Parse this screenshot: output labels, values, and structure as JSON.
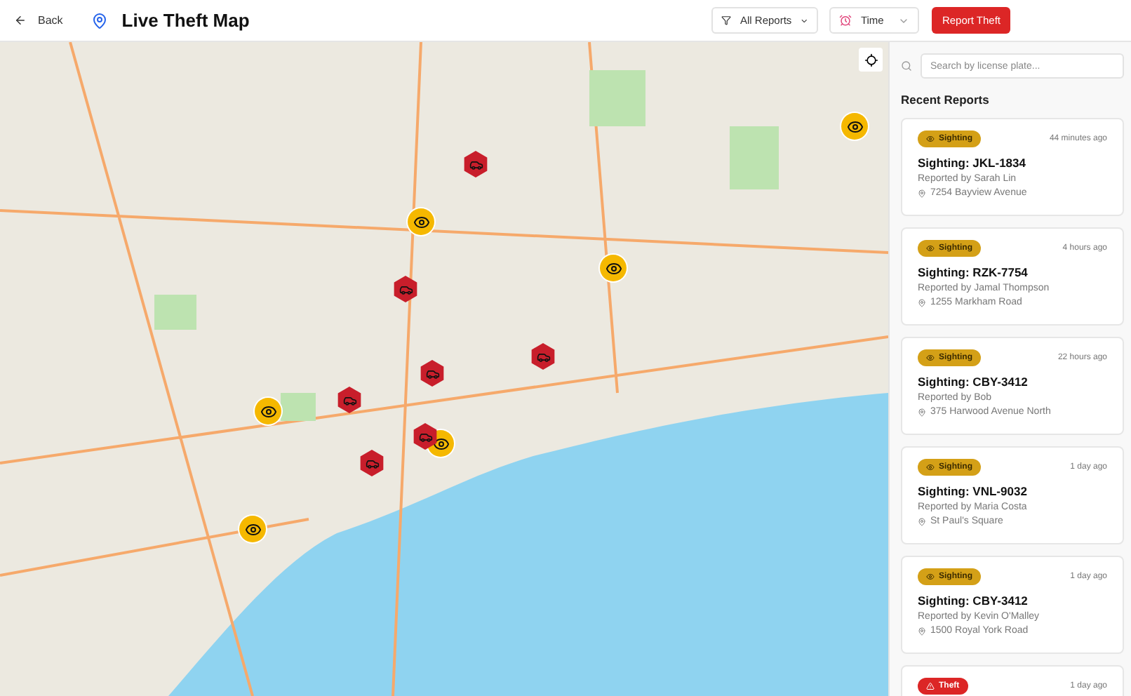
{
  "header": {
    "back": "Back",
    "title": "Live Theft Map",
    "filter": "All Reports",
    "time": "Time",
    "report_button": "Report Theft"
  },
  "map": {
    "markers": [
      {
        "kind": "sighting"
      },
      {
        "kind": "sighting"
      },
      {
        "kind": "sighting"
      },
      {
        "kind": "sighting"
      },
      {
        "kind": "sighting"
      },
      {
        "kind": "sighting"
      },
      {
        "kind": "theft"
      },
      {
        "kind": "theft"
      },
      {
        "kind": "theft"
      },
      {
        "kind": "theft"
      },
      {
        "kind": "theft"
      },
      {
        "kind": "theft"
      },
      {
        "kind": "theft"
      }
    ]
  },
  "sidebar": {
    "search": {
      "placeholder": "Search by license plate..."
    },
    "heading": "Recent Reports",
    "reports": [
      {
        "kind": "sighting",
        "badge": "Sighting",
        "time": "44 minutes ago",
        "title": "Sighting: JKL-1834",
        "reporter": "Reported by Sarah Lin",
        "address": "7254 Bayview Avenue"
      },
      {
        "kind": "sighting",
        "badge": "Sighting",
        "time": "4 hours ago",
        "title": "Sighting: RZK-7754",
        "reporter": "Reported by Jamal Thompson",
        "address": "1255 Markham Road"
      },
      {
        "kind": "sighting",
        "badge": "Sighting",
        "time": "22 hours ago",
        "title": "Sighting: CBY-3412",
        "reporter": "Reported by Bob",
        "address": "375 Harwood Avenue North"
      },
      {
        "kind": "sighting",
        "badge": "Sighting",
        "time": "1 day ago",
        "title": "Sighting: VNL-9032",
        "reporter": "Reported by Maria Costa",
        "address": "St Paul's Square"
      },
      {
        "kind": "sighting",
        "badge": "Sighting",
        "time": "1 day ago",
        "title": "Sighting: CBY-3412",
        "reporter": "Reported by Kevin O'Malley",
        "address": "1500 Royal York Road"
      },
      {
        "kind": "theft",
        "badge": "Theft",
        "time": "1 day ago"
      }
    ]
  }
}
